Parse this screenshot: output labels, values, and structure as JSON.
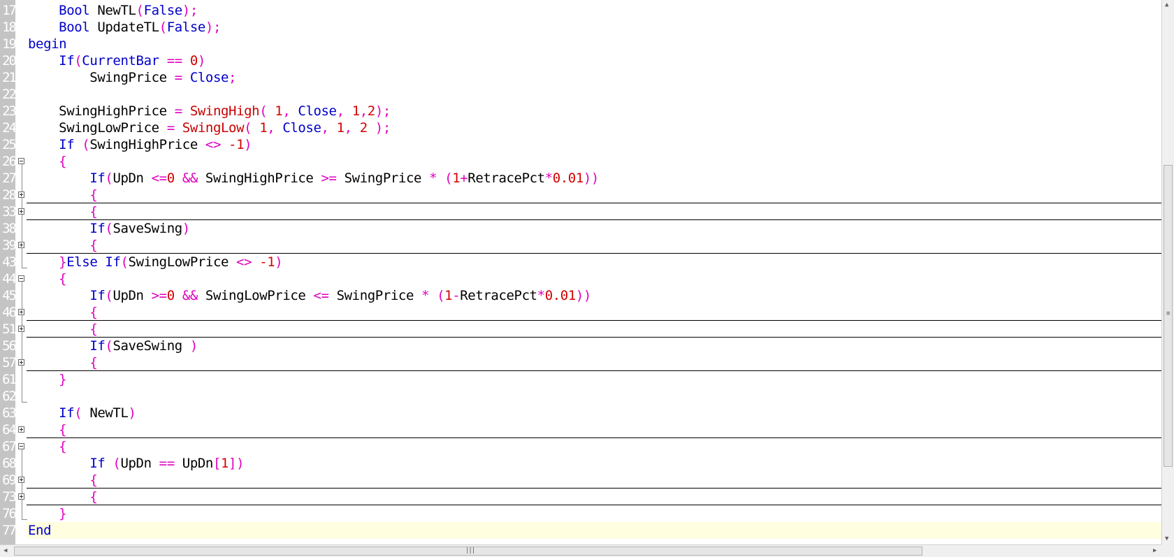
{
  "editor": {
    "line_numbers": [
      "17",
      "18",
      "19",
      "20",
      "21",
      "22",
      "23",
      "24",
      "25",
      "26",
      "27",
      "28",
      "33",
      "38",
      "39",
      "43",
      "44",
      "45",
      "46",
      "51",
      "56",
      "57",
      "61",
      "62",
      "63",
      "64",
      "67",
      "68",
      "69",
      "73",
      "76",
      "77"
    ],
    "lines": [
      [
        {
          "t": "    "
        },
        {
          "t": "Bool",
          "c": "k"
        },
        {
          "t": " NewTL"
        },
        {
          "t": "(",
          "c": "o"
        },
        {
          "t": "False",
          "c": "k"
        },
        {
          "t": ");",
          "c": "o"
        }
      ],
      [
        {
          "t": "    "
        },
        {
          "t": "Bool",
          "c": "k"
        },
        {
          "t": " UpdateTL"
        },
        {
          "t": "(",
          "c": "o"
        },
        {
          "t": "False",
          "c": "k"
        },
        {
          "t": ");",
          "c": "o"
        }
      ],
      [
        {
          "t": "begin",
          "c": "k"
        }
      ],
      [
        {
          "t": "    "
        },
        {
          "t": "If",
          "c": "k"
        },
        {
          "t": "(",
          "c": "o"
        },
        {
          "t": "CurrentBar",
          "c": "b"
        },
        {
          "t": " == ",
          "c": "o"
        },
        {
          "t": "0",
          "c": "n"
        },
        {
          "t": ")",
          "c": "o"
        }
      ],
      [
        {
          "t": "        SwingPrice "
        },
        {
          "t": "=",
          "c": "o"
        },
        {
          "t": " "
        },
        {
          "t": "Close",
          "c": "b"
        },
        {
          "t": ";",
          "c": "o"
        }
      ],
      [],
      [
        {
          "t": "    SwingHighPrice "
        },
        {
          "t": "=",
          "c": "o"
        },
        {
          "t": " "
        },
        {
          "t": "SwingHigh",
          "c": "f"
        },
        {
          "t": "( ",
          "c": "o"
        },
        {
          "t": "1",
          "c": "n"
        },
        {
          "t": ", ",
          "c": "o"
        },
        {
          "t": "Close",
          "c": "b"
        },
        {
          "t": ", ",
          "c": "o"
        },
        {
          "t": "1",
          "c": "n"
        },
        {
          "t": ",",
          "c": "o"
        },
        {
          "t": "2",
          "c": "n"
        },
        {
          "t": ");",
          "c": "o"
        }
      ],
      [
        {
          "t": "    SwingLowPrice "
        },
        {
          "t": "=",
          "c": "o"
        },
        {
          "t": " "
        },
        {
          "t": "SwingLow",
          "c": "f"
        },
        {
          "t": "( ",
          "c": "o"
        },
        {
          "t": "1",
          "c": "n"
        },
        {
          "t": ", ",
          "c": "o"
        },
        {
          "t": "Close",
          "c": "b"
        },
        {
          "t": ", ",
          "c": "o"
        },
        {
          "t": "1",
          "c": "n"
        },
        {
          "t": ", ",
          "c": "o"
        },
        {
          "t": "2",
          "c": "n"
        },
        {
          "t": " );",
          "c": "o"
        }
      ],
      [
        {
          "t": "    "
        },
        {
          "t": "If",
          "c": "k"
        },
        {
          "t": " (",
          "c": "o"
        },
        {
          "t": "SwingHighPrice "
        },
        {
          "t": "<>",
          "c": "o"
        },
        {
          "t": " "
        },
        {
          "t": "-1",
          "c": "n"
        },
        {
          "t": ")",
          "c": "o"
        }
      ],
      [
        {
          "t": "    "
        },
        {
          "t": "{",
          "c": "o"
        }
      ],
      [
        {
          "t": "        "
        },
        {
          "t": "If",
          "c": "k"
        },
        {
          "t": "(",
          "c": "o"
        },
        {
          "t": "UpDn "
        },
        {
          "t": "<=",
          "c": "o"
        },
        {
          "t": "0",
          "c": "n"
        },
        {
          "t": " "
        },
        {
          "t": "&&",
          "c": "o"
        },
        {
          "t": " SwingHighPrice "
        },
        {
          "t": ">=",
          "c": "o"
        },
        {
          "t": " SwingPrice "
        },
        {
          "t": "*",
          "c": "o"
        },
        {
          "t": " "
        },
        {
          "t": "(",
          "c": "o"
        },
        {
          "t": "1",
          "c": "n"
        },
        {
          "t": "+",
          "c": "o"
        },
        {
          "t": "RetracePct"
        },
        {
          "t": "*",
          "c": "o"
        },
        {
          "t": "0.01",
          "c": "n"
        },
        {
          "t": "))",
          "c": "o"
        }
      ],
      [
        {
          "t": "        "
        },
        {
          "t": "{",
          "c": "o"
        }
      ],
      [
        {
          "t": "        "
        },
        {
          "t": "{",
          "c": "o"
        }
      ],
      [
        {
          "t": "        "
        },
        {
          "t": "If",
          "c": "k"
        },
        {
          "t": "(",
          "c": "o"
        },
        {
          "t": "SaveSwing"
        },
        {
          "t": ")",
          "c": "o"
        }
      ],
      [
        {
          "t": "        "
        },
        {
          "t": "{",
          "c": "o"
        }
      ],
      [
        {
          "t": "    "
        },
        {
          "t": "}",
          "c": "o"
        },
        {
          "t": "Else",
          "c": "k"
        },
        {
          "t": " "
        },
        {
          "t": "If",
          "c": "k"
        },
        {
          "t": "(",
          "c": "o"
        },
        {
          "t": "SwingLowPrice "
        },
        {
          "t": "<>",
          "c": "o"
        },
        {
          "t": " "
        },
        {
          "t": "-1",
          "c": "n"
        },
        {
          "t": ")",
          "c": "o"
        }
      ],
      [
        {
          "t": "    "
        },
        {
          "t": "{",
          "c": "o"
        }
      ],
      [
        {
          "t": "        "
        },
        {
          "t": "If",
          "c": "k"
        },
        {
          "t": "(",
          "c": "o"
        },
        {
          "t": "UpDn "
        },
        {
          "t": ">=",
          "c": "o"
        },
        {
          "t": "0",
          "c": "n"
        },
        {
          "t": " "
        },
        {
          "t": "&&",
          "c": "o"
        },
        {
          "t": " SwingLowPrice "
        },
        {
          "t": "<=",
          "c": "o"
        },
        {
          "t": " SwingPrice "
        },
        {
          "t": "*",
          "c": "o"
        },
        {
          "t": " "
        },
        {
          "t": "(",
          "c": "o"
        },
        {
          "t": "1",
          "c": "n"
        },
        {
          "t": "-",
          "c": "o"
        },
        {
          "t": "RetracePct"
        },
        {
          "t": "*",
          "c": "o"
        },
        {
          "t": "0.01",
          "c": "n"
        },
        {
          "t": "))",
          "c": "o"
        }
      ],
      [
        {
          "t": "        "
        },
        {
          "t": "{",
          "c": "o"
        }
      ],
      [
        {
          "t": "        "
        },
        {
          "t": "{",
          "c": "o"
        }
      ],
      [
        {
          "t": "        "
        },
        {
          "t": "If",
          "c": "k"
        },
        {
          "t": "(",
          "c": "o"
        },
        {
          "t": "SaveSwing "
        },
        {
          "t": ")",
          "c": "o"
        }
      ],
      [
        {
          "t": "        "
        },
        {
          "t": "{",
          "c": "o"
        }
      ],
      [
        {
          "t": "    "
        },
        {
          "t": "}",
          "c": "o"
        }
      ],
      [],
      [
        {
          "t": "    "
        },
        {
          "t": "If",
          "c": "k"
        },
        {
          "t": "( ",
          "c": "o"
        },
        {
          "t": "NewTL"
        },
        {
          "t": ")",
          "c": "o"
        }
      ],
      [
        {
          "t": "    "
        },
        {
          "t": "{",
          "c": "o"
        }
      ],
      [
        {
          "t": "    "
        },
        {
          "t": "{",
          "c": "o"
        }
      ],
      [
        {
          "t": "        "
        },
        {
          "t": "If",
          "c": "k"
        },
        {
          "t": " (",
          "c": "o"
        },
        {
          "t": "UpDn "
        },
        {
          "t": "==",
          "c": "o"
        },
        {
          "t": " UpDn"
        },
        {
          "t": "[",
          "c": "o"
        },
        {
          "t": "1",
          "c": "n"
        },
        {
          "t": "])",
          "c": "o"
        }
      ],
      [
        {
          "t": "        "
        },
        {
          "t": "{",
          "c": "o"
        }
      ],
      [
        {
          "t": "        "
        },
        {
          "t": "{",
          "c": "o"
        }
      ],
      [
        {
          "t": "    "
        },
        {
          "t": "}",
          "c": "o"
        }
      ],
      [
        {
          "t": "End",
          "c": "k"
        }
      ]
    ],
    "fold_markers": [
      {
        "line": 9,
        "state": "expanded"
      },
      {
        "line": 11,
        "state": "collapsed"
      },
      {
        "line": 12,
        "state": "collapsed"
      },
      {
        "line": 14,
        "state": "collapsed"
      },
      {
        "line": 16,
        "state": "expanded"
      },
      {
        "line": 18,
        "state": "collapsed"
      },
      {
        "line": 19,
        "state": "collapsed"
      },
      {
        "line": 21,
        "state": "collapsed"
      },
      {
        "line": 25,
        "state": "collapsed"
      },
      {
        "line": 26,
        "state": "expanded"
      },
      {
        "line": 28,
        "state": "collapsed"
      },
      {
        "line": 29,
        "state": "collapsed"
      }
    ],
    "collapsed_separator_lines": [
      11,
      12,
      14,
      18,
      19,
      21,
      25,
      28,
      29
    ],
    "fold_ranges": [
      [
        9,
        15
      ],
      [
        16,
        23
      ],
      [
        26,
        30
      ]
    ],
    "current_line": 31
  },
  "colors": {
    "keyword": "#0000c8",
    "operator": "#e000c0",
    "number": "#d40000",
    "function": "#c80000",
    "current_line_bg": "#fffedf",
    "gutter_bg": "#c4c4c4"
  }
}
